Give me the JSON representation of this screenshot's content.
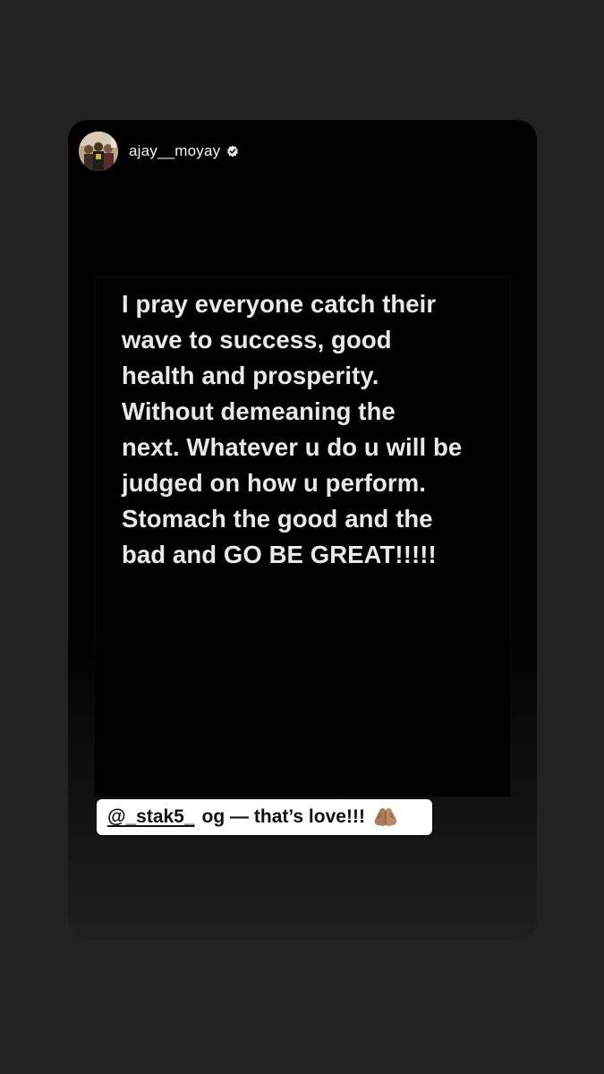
{
  "post": {
    "username": "ajay__moyay",
    "verified_icon": "verified-badge-icon",
    "avatar_icon": "profile-photo-avatar"
  },
  "media": {
    "quote_text": "I pray everyone catch their\nwave to success, good\nhealth and prosperity.\nWithout demeaning the\nnext. Whatever u do u will be\njudged on how u perform.\nStomach the good and the\nbad and GO BE GREAT!!!!!"
  },
  "sticker": {
    "mention": "@_stak5_",
    "caption": "og — that’s love!!!",
    "emoji_icon": "praying-hands-icon"
  },
  "colors": {
    "page_background": "#222222",
    "card_background": "#000000",
    "text": "#e9e9e9",
    "sticker_background": "#ffffff",
    "sticker_text": "#111111"
  }
}
